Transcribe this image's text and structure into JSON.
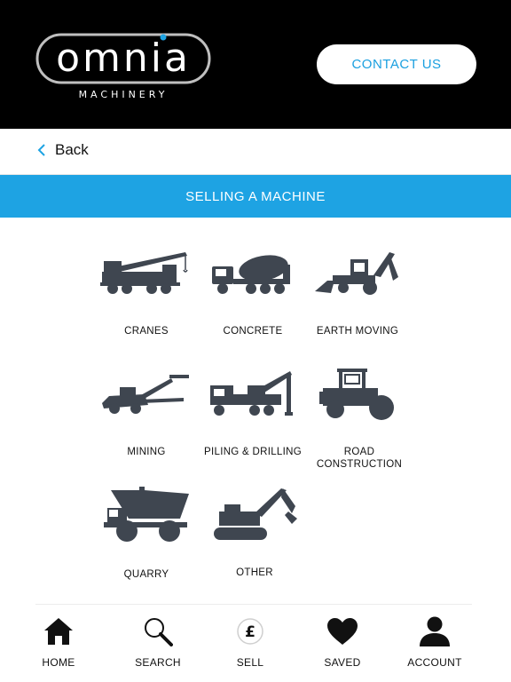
{
  "header": {
    "logo_word": "omnia",
    "logo_sub": "MACHINERY",
    "contact_label": "CONTACT US"
  },
  "back": {
    "label": "Back"
  },
  "banner": {
    "title": "SELLING A MACHINE"
  },
  "categories": [
    {
      "label": "CRANES",
      "icon": "crane-icon"
    },
    {
      "label": "CONCRETE",
      "icon": "concrete-mixer-icon"
    },
    {
      "label": "EARTH MOVING",
      "icon": "backhoe-icon"
    },
    {
      "label": "MINING",
      "icon": "mining-drill-icon"
    },
    {
      "label": "PILING & DRILLING",
      "icon": "piling-rig-icon"
    },
    {
      "label": "ROAD\nCONSTRUCTION",
      "icon": "road-roller-icon"
    },
    {
      "label": "QUARRY",
      "icon": "dump-truck-icon"
    },
    {
      "label": "OTHER",
      "icon": "excavator-icon"
    }
  ],
  "nav": [
    {
      "label": "HOME",
      "icon": "home-icon"
    },
    {
      "label": "SEARCH",
      "icon": "search-icon"
    },
    {
      "label": "SELL",
      "icon": "pound-icon"
    },
    {
      "label": "SAVED",
      "icon": "heart-icon"
    },
    {
      "label": "ACCOUNT",
      "icon": "account-icon"
    }
  ],
  "colors": {
    "accent": "#1ea3e3",
    "header_bg": "#000000",
    "icon_fill": "#3f4650"
  }
}
